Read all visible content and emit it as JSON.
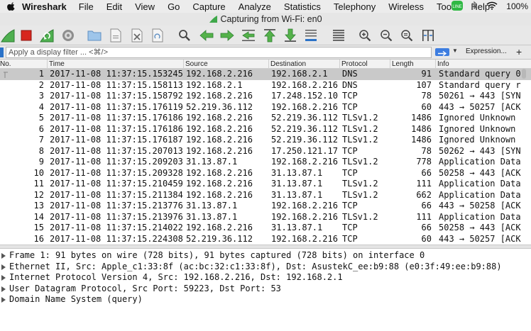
{
  "menubar": {
    "app": "Wireshark",
    "items": [
      "File",
      "Edit",
      "View",
      "Go",
      "Capture",
      "Analyze",
      "Statistics",
      "Telephony",
      "Wireless",
      "Tools",
      "Help"
    ],
    "battery": "100%"
  },
  "window": {
    "title": "Capturing from Wi-Fi: en0"
  },
  "toolbar": {
    "icons": [
      "shark-fin-start-icon",
      "stop-capture-icon",
      "restart-capture-icon",
      "capture-options-icon",
      "open-file-icon",
      "save-file-icon",
      "close-file-icon",
      "reload-file-icon",
      "find-packet-icon",
      "go-back-icon",
      "go-forward-icon",
      "go-to-packet-icon",
      "go-first-icon",
      "go-last-icon",
      "autoscroll-icon",
      "colorize-icon",
      "zoom-in-icon",
      "zoom-out-icon",
      "zoom-normal-icon",
      "resize-columns-icon"
    ]
  },
  "filter": {
    "placeholder": "Apply a display filter ... <⌘/>",
    "expression_label": "Expression...",
    "plus_label": "+"
  },
  "columns": {
    "no": "No.",
    "time": "Time",
    "source": "Source",
    "destination": "Destination",
    "protocol": "Protocol",
    "length": "Length",
    "info": "Info"
  },
  "packets": [
    {
      "no": "1",
      "time": "2017-11-08 11:37:15.153245",
      "src": "192.168.2.216",
      "dst": "192.168.2.1",
      "proto": "DNS",
      "len": "91",
      "info": "Standard query 0"
    },
    {
      "no": "2",
      "time": "2017-11-08 11:37:15.158113",
      "src": "192.168.2.1",
      "dst": "192.168.2.216",
      "proto": "DNS",
      "len": "107",
      "info": "Standard query r"
    },
    {
      "no": "3",
      "time": "2017-11-08 11:37:15.158792",
      "src": "192.168.2.216",
      "dst": "17.248.152.10",
      "proto": "TCP",
      "len": "78",
      "info": "50261 → 443 [SYN"
    },
    {
      "no": "4",
      "time": "2017-11-08 11:37:15.176119",
      "src": "52.219.36.112",
      "dst": "192.168.2.216",
      "proto": "TCP",
      "len": "60",
      "info": "443 → 50257 [ACK"
    },
    {
      "no": "5",
      "time": "2017-11-08 11:37:15.176186",
      "src": "192.168.2.216",
      "dst": "52.219.36.112",
      "proto": "TLSv1.2",
      "len": "1486",
      "info": "Ignored Unknown"
    },
    {
      "no": "6",
      "time": "2017-11-08 11:37:15.176186",
      "src": "192.168.2.216",
      "dst": "52.219.36.112",
      "proto": "TLSv1.2",
      "len": "1486",
      "info": "Ignored Unknown"
    },
    {
      "no": "7",
      "time": "2017-11-08 11:37:15.176187",
      "src": "192.168.2.216",
      "dst": "52.219.36.112",
      "proto": "TLSv1.2",
      "len": "1486",
      "info": "Ignored Unknown"
    },
    {
      "no": "8",
      "time": "2017-11-08 11:37:15.207013",
      "src": "192.168.2.216",
      "dst": "17.250.121.17",
      "proto": "TCP",
      "len": "78",
      "info": "50262 → 443 [SYN"
    },
    {
      "no": "9",
      "time": "2017-11-08 11:37:15.209203",
      "src": "31.13.87.1",
      "dst": "192.168.2.216",
      "proto": "TLSv1.2",
      "len": "778",
      "info": "Application Data"
    },
    {
      "no": "10",
      "time": "2017-11-08 11:37:15.209328",
      "src": "192.168.2.216",
      "dst": "31.13.87.1",
      "proto": "TCP",
      "len": "66",
      "info": "50258 → 443 [ACK"
    },
    {
      "no": "11",
      "time": "2017-11-08 11:37:15.210459",
      "src": "192.168.2.216",
      "dst": "31.13.87.1",
      "proto": "TLSv1.2",
      "len": "111",
      "info": "Application Data"
    },
    {
      "no": "12",
      "time": "2017-11-08 11:37:15.211384",
      "src": "192.168.2.216",
      "dst": "31.13.87.1",
      "proto": "TLSv1.2",
      "len": "662",
      "info": "Application Data"
    },
    {
      "no": "13",
      "time": "2017-11-08 11:37:15.213776",
      "src": "31.13.87.1",
      "dst": "192.168.2.216",
      "proto": "TCP",
      "len": "66",
      "info": "443 → 50258 [ACK"
    },
    {
      "no": "14",
      "time": "2017-11-08 11:37:15.213976",
      "src": "31.13.87.1",
      "dst": "192.168.2.216",
      "proto": "TLSv1.2",
      "len": "111",
      "info": "Application Data"
    },
    {
      "no": "15",
      "time": "2017-11-08 11:37:15.214022",
      "src": "192.168.2.216",
      "dst": "31.13.87.1",
      "proto": "TCP",
      "len": "66",
      "info": "50258 → 443 [ACK"
    },
    {
      "no": "16",
      "time": "2017-11-08 11:37:15.224308",
      "src": "52.219.36.112",
      "dst": "192.168.2.216",
      "proto": "TCP",
      "len": "60",
      "info": "443 → 50257 [ACK"
    }
  ],
  "details": [
    "Frame 1: 91 bytes on wire (728 bits), 91 bytes captured (728 bits) on interface 0",
    "Ethernet II, Src: Apple_c1:33:8f (ac:bc:32:c1:33:8f), Dst: AsustekC_ee:b9:88 (e0:3f:49:ee:b9:88)",
    "Internet Protocol Version 4, Src: 192.168.2.216, Dst: 192.168.2.1",
    "User Datagram Protocol, Src Port: 59223, Dst Port: 53",
    "Domain Name System (query)"
  ],
  "colors": {
    "selected_row": "#c9c9c9",
    "fin_green": "#3fa84a",
    "stop_red": "#d7261e",
    "nav_green": "#54b24a"
  }
}
